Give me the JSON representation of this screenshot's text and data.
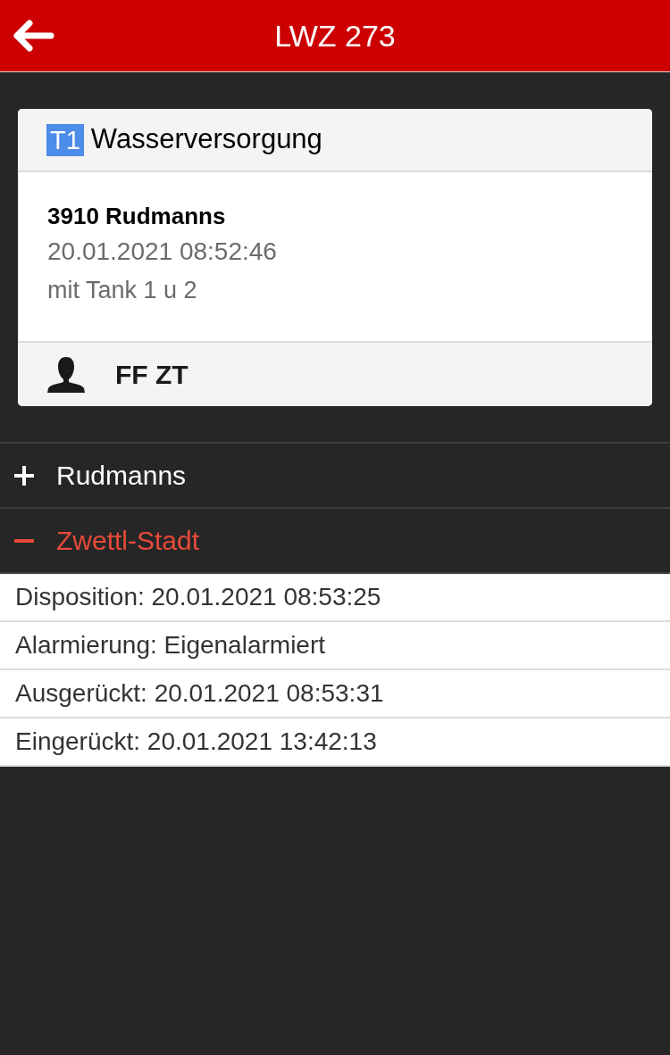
{
  "header": {
    "title": "LWZ 273"
  },
  "incident": {
    "badge": "T1",
    "category": "Wasserversorgung",
    "location": "3910 Rudmanns",
    "timestamp": "20.01.2021 08:52:46",
    "note": "mit Tank 1 u 2",
    "unit": "FF ZT"
  },
  "sections": [
    {
      "title": "Rudmanns",
      "expanded": false
    },
    {
      "title": "Zwettl-Stadt",
      "expanded": true,
      "entries": [
        "Disposition: 20.01.2021 08:53:25",
        "Alarmierung: Eigenalarmiert",
        "Ausgerückt: 20.01.2021 08:53:31",
        "Eingerückt: 20.01.2021 13:42:13"
      ]
    }
  ]
}
